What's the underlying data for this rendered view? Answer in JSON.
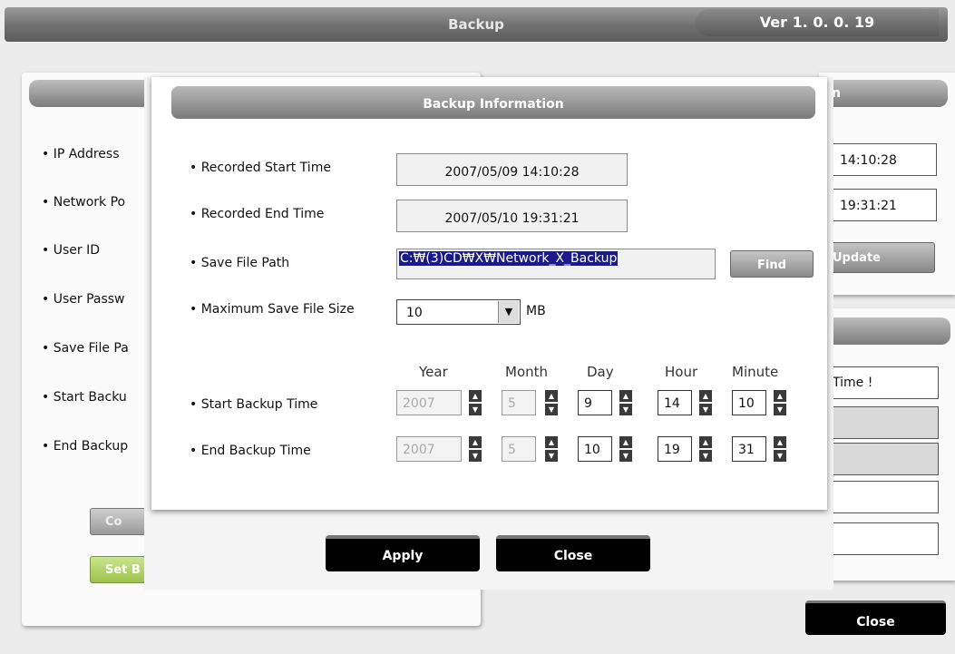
{
  "window": {
    "title": "Backup",
    "version": "Ver 1. 0. 0. 19"
  },
  "background_left": {
    "labels": [
      "• IP Address",
      "• Network Po",
      "• User ID",
      "• User Passw",
      "• Save File Pa",
      "• Start Backu",
      "• End Backup"
    ],
    "connect_button": "Co",
    "set_backup_button": "Set B"
  },
  "background_right": {
    "header": "n",
    "start_time": "14:10:28",
    "end_time": "19:31:21",
    "update_button": "Update",
    "message": "Time !"
  },
  "main_close_button": "Close",
  "dialog": {
    "title": "Backup Information",
    "recorded_start_label": "• Recorded Start Time",
    "recorded_start_value": "2007/05/09 14:10:28",
    "recorded_end_label": "• Recorded End Time",
    "recorded_end_value": "2007/05/10 19:31:21",
    "save_path_label": "• Save File Path",
    "save_path_value": "C:₩(3)CD₩X₩Network_X_Backup",
    "find_button": "Find",
    "max_size_label": "• Maximum Save File Size",
    "max_size_value": "10",
    "max_size_unit": "MB",
    "columns": {
      "year": "Year",
      "month": "Month",
      "day": "Day",
      "hour": "Hour",
      "minute": "Minute"
    },
    "start_backup": {
      "label": "• Start Backup Time",
      "year": "2007",
      "month": "5",
      "day": "9",
      "hour": "14",
      "minute": "10"
    },
    "end_backup": {
      "label": "• End Backup Time",
      "year": "2007",
      "month": "5",
      "day": "10",
      "hour": "19",
      "minute": "31"
    },
    "apply_button": "Apply",
    "close_button": "Close"
  }
}
